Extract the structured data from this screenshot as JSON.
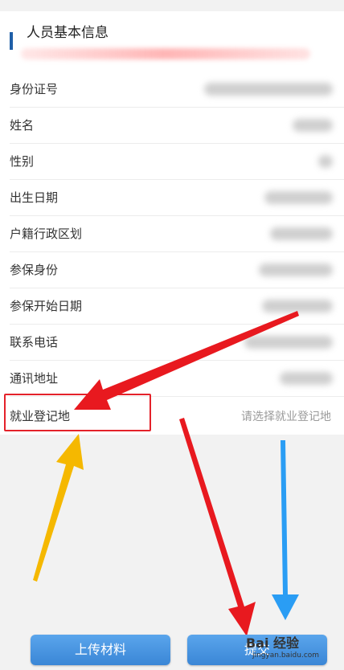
{
  "section": {
    "title": "人员基本信息"
  },
  "fields": [
    {
      "label": "身份证号"
    },
    {
      "label": "姓名"
    },
    {
      "label": "性别"
    },
    {
      "label": "出生日期"
    },
    {
      "label": "户籍行政区划"
    },
    {
      "label": "参保身份"
    },
    {
      "label": "参保开始日期"
    },
    {
      "label": "联系电话"
    },
    {
      "label": "通讯地址"
    },
    {
      "label": "就业登记地",
      "placeholder": "请选择就业登记地"
    }
  ],
  "buttons": {
    "upload": "上传材料",
    "submit": "提交"
  },
  "watermark": {
    "brand": "Bai 经验",
    "url": "jingyan.baidu.com"
  },
  "colors": {
    "accent_bar": "#1f5fa8",
    "button": "#3a86d6",
    "highlight": "#e4222a",
    "arrow_red": "#e8191f",
    "arrow_yellow": "#f5b800",
    "arrow_blue": "#2a9df4"
  }
}
